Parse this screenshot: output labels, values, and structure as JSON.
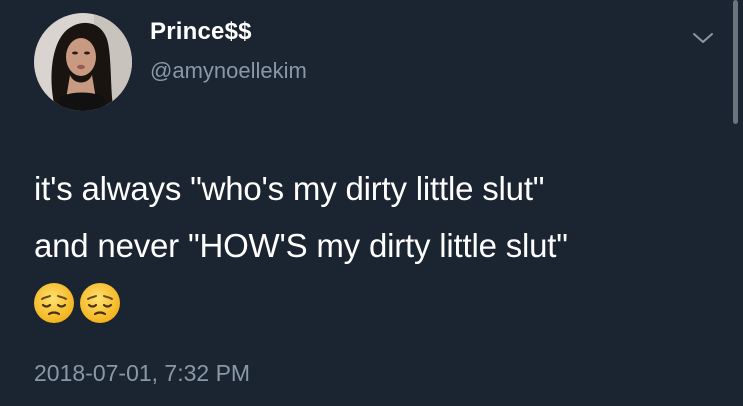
{
  "tweet": {
    "author": {
      "display_name": "Prince$$",
      "handle": "@amynoellekim"
    },
    "text_lines": [
      "it's always \"who's my dirty little slut\"",
      "and never \"HOW'S my dirty little slut\""
    ],
    "emojis": [
      "pensive-face-emoji",
      "pensive-face-emoji"
    ],
    "timestamp": "2018-07-01, 7:32 PM"
  },
  "colors": {
    "background": "#1b2431",
    "text_primary": "#ffffff",
    "text_secondary": "#8899a6"
  }
}
